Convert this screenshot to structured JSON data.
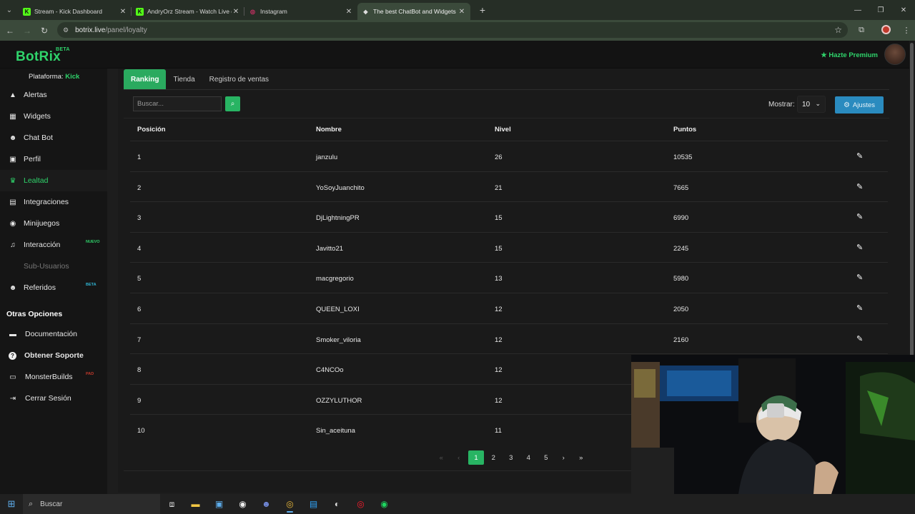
{
  "browser": {
    "tabs": [
      {
        "title": "Stream - Kick Dashboard",
        "icon": "kick-icon",
        "icon_glyph": "K",
        "icon_color": "#53fc18"
      },
      {
        "title": "AndryOrz Stream - Watch Live o",
        "icon": "kick-icon",
        "icon_glyph": "K",
        "icon_color": "#53fc18"
      },
      {
        "title": "Instagram",
        "icon": "instagram-icon",
        "icon_glyph": "◎",
        "icon_color": "#e1306c"
      },
      {
        "title": "The best ChatBot and Widgets f",
        "icon": "botrix-icon",
        "icon_glyph": "◆",
        "icon_color": "#dddddd"
      }
    ],
    "url_domain": "botrix.live",
    "url_path": "/panel/loyalty"
  },
  "app": {
    "logo": "BotRix",
    "logo_badge": "BETA",
    "premium_label": "Hazte Premium",
    "platform_label": "Plataforma:",
    "platform_value": "Kick"
  },
  "sidebar": {
    "items": [
      {
        "label": "Alertas",
        "icon": "warning-icon",
        "glyph": "▲"
      },
      {
        "label": "Widgets",
        "icon": "grid-icon",
        "glyph": "▦"
      },
      {
        "label": "Chat Bot",
        "icon": "robot-icon",
        "glyph": "☻"
      },
      {
        "label": "Perfil",
        "icon": "id-card-icon",
        "glyph": "▣"
      },
      {
        "label": "Lealtad",
        "icon": "trophy-icon",
        "glyph": "♛",
        "active": true
      },
      {
        "label": "Integraciones",
        "icon": "server-icon",
        "glyph": "▤"
      },
      {
        "label": "Minijuegos",
        "icon": "gamepad-icon",
        "glyph": "◉"
      },
      {
        "label": "Interacción",
        "icon": "music-icon",
        "glyph": "♫",
        "badge": "NUEVO",
        "badge_color": "#2fd36b"
      },
      {
        "label": "Sub-Usuarios",
        "icon": "sub-users-icon",
        "glyph": "",
        "disabled": true
      },
      {
        "label": "Referidos",
        "icon": "users-icon",
        "glyph": "☻",
        "badge": "BETA",
        "badge_color": "#2fb4d3"
      }
    ],
    "other_title": "Otras Opciones",
    "options": [
      {
        "label": "Documentación",
        "icon": "book-icon",
        "glyph": "▬",
        "bold": false
      },
      {
        "label": "Obtener Soporte",
        "icon": "question-icon",
        "glyph": "?",
        "bold": true
      },
      {
        "label": "MonsterBuilds",
        "icon": "monitor-icon",
        "glyph": "▭",
        "bold": false,
        "badge": "PAD",
        "badge_color": "#c0392b"
      },
      {
        "label": "Cerrar Sesión",
        "icon": "logout-icon",
        "glyph": "⇥",
        "bold": false
      }
    ]
  },
  "main": {
    "tabs": [
      "Ranking",
      "Tienda",
      "Registro de ventas"
    ],
    "search_placeholder": "Buscar...",
    "show_label": "Mostrar:",
    "show_value": "10",
    "settings_label": "Ajustes",
    "columns": [
      "Posición",
      "Nombre",
      "Nivel",
      "Puntos"
    ],
    "rows": [
      {
        "pos": "1",
        "name": "janzulu",
        "level": "26",
        "points": "10535"
      },
      {
        "pos": "2",
        "name": "YoSoyJuanchito",
        "level": "21",
        "points": "7665"
      },
      {
        "pos": "3",
        "name": "DjLightningPR",
        "level": "15",
        "points": "6990"
      },
      {
        "pos": "4",
        "name": "Javitto21",
        "level": "15",
        "points": "2245"
      },
      {
        "pos": "5",
        "name": "macgregorio",
        "level": "13",
        "points": "5980"
      },
      {
        "pos": "6",
        "name": "QUEEN_LOXI",
        "level": "12",
        "points": "2050"
      },
      {
        "pos": "7",
        "name": "Smoker_viloria",
        "level": "12",
        "points": "2160"
      },
      {
        "pos": "8",
        "name": "C4NCOo",
        "level": "12",
        "points": ""
      },
      {
        "pos": "9",
        "name": "OZZYLUTHOR",
        "level": "12",
        "points": ""
      },
      {
        "pos": "10",
        "name": "Sin_aceituna",
        "level": "11",
        "points": ""
      }
    ],
    "pagination": {
      "first": "«",
      "prev": "‹",
      "pages": [
        "1",
        "2",
        "3",
        "4",
        "5"
      ],
      "current": "1",
      "next": "›",
      "last": "»"
    }
  },
  "taskbar": {
    "search_label": "Buscar"
  }
}
